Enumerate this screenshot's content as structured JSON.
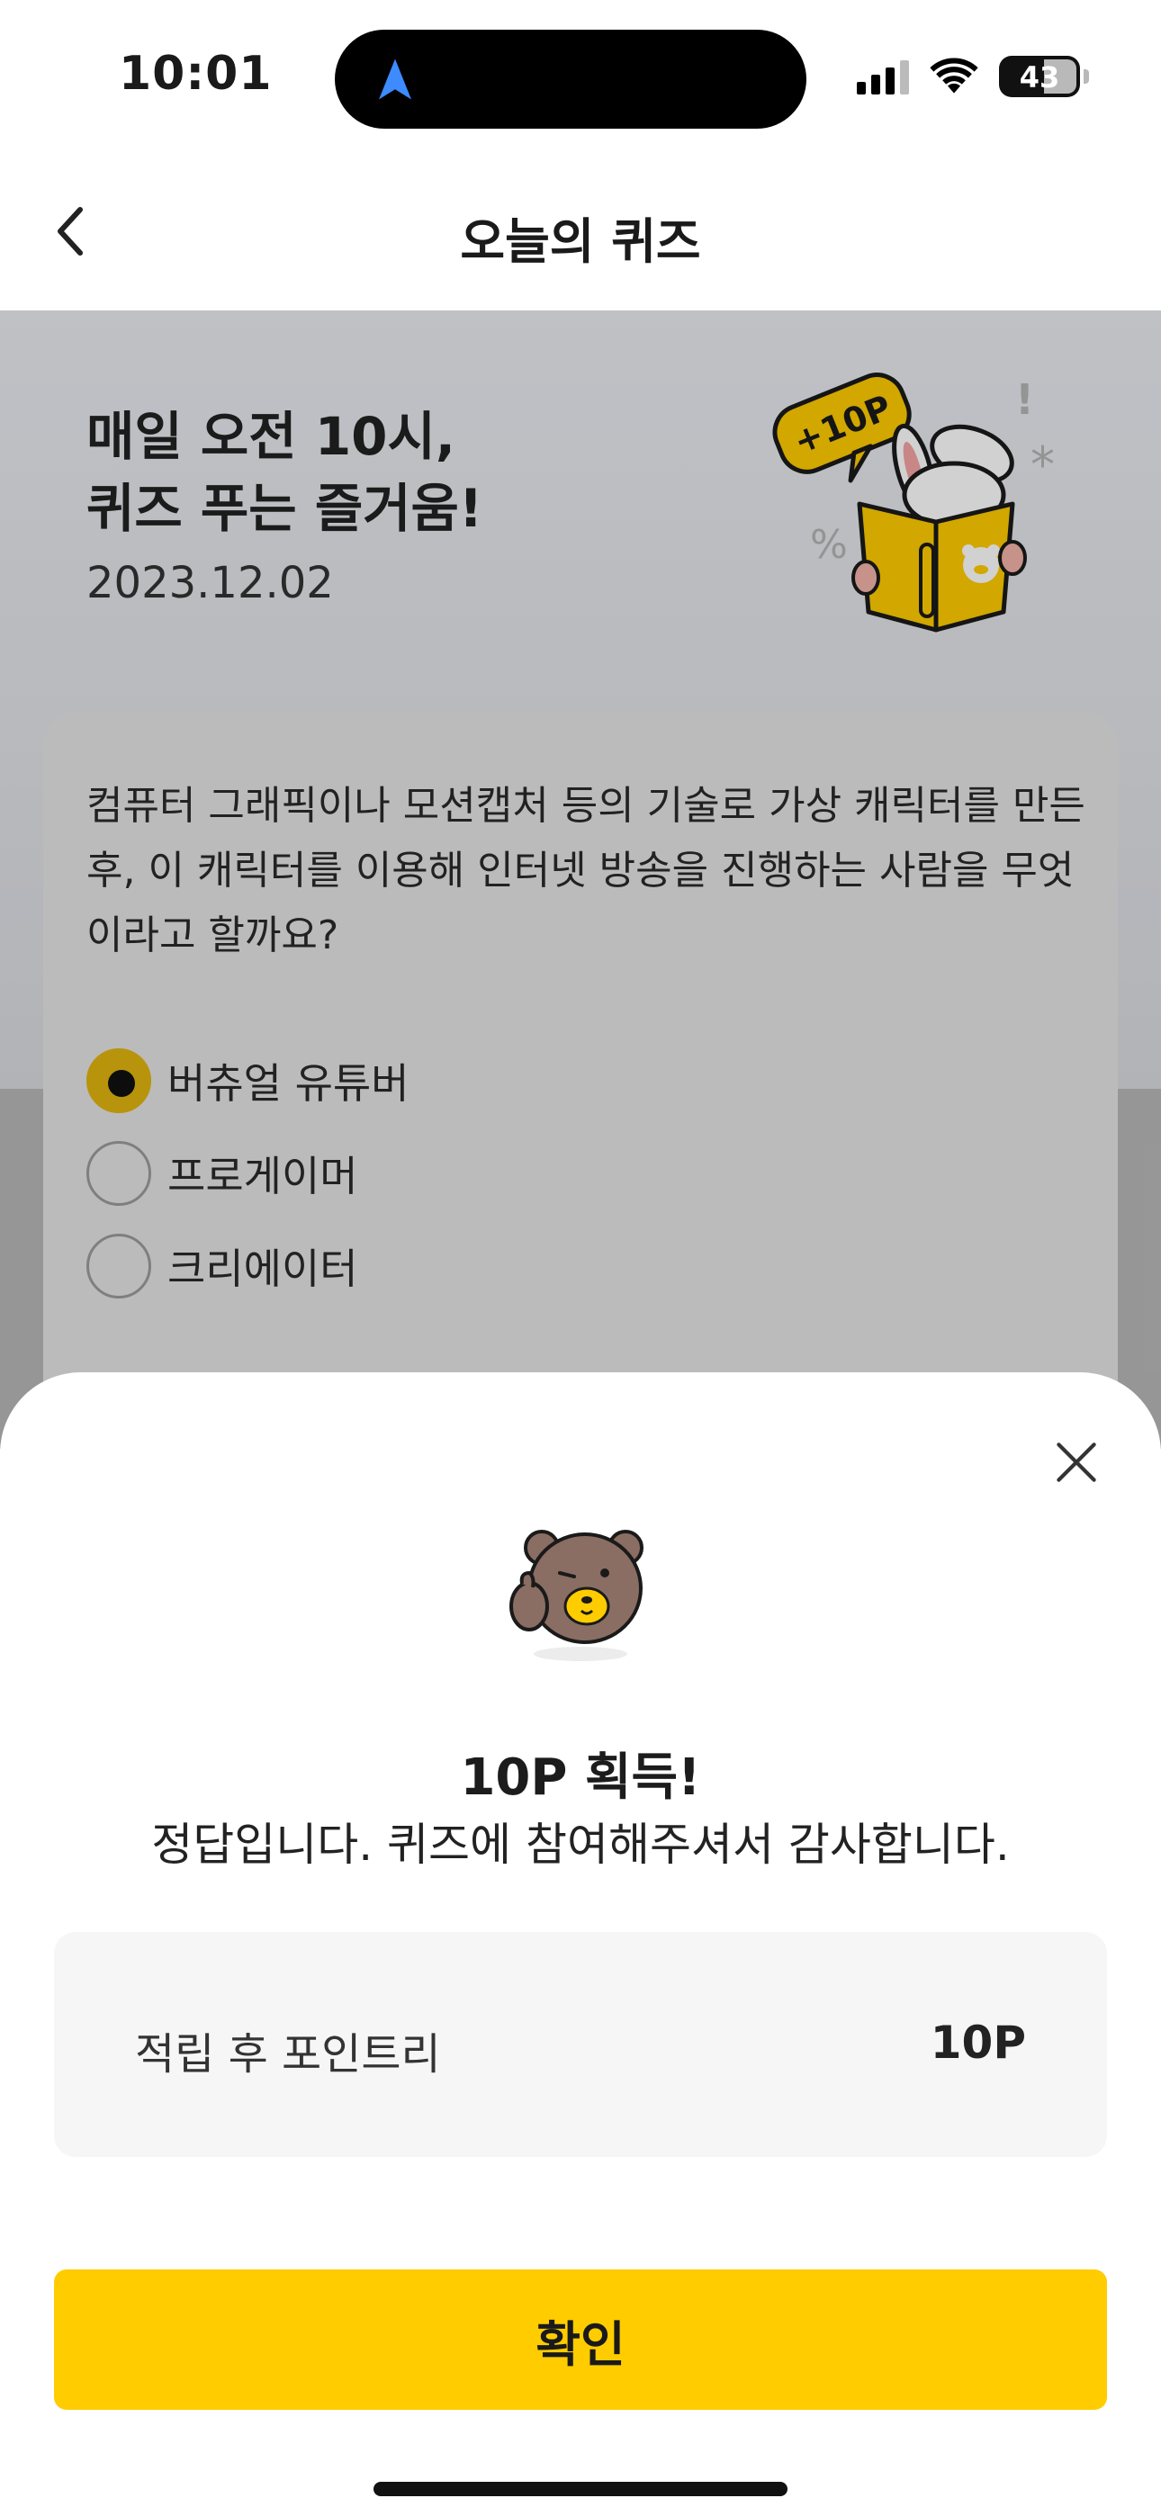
{
  "status_bar": {
    "time": "10:01",
    "battery": "43",
    "icons": [
      "location-arrow-icon",
      "signal-icon",
      "wifi-icon",
      "battery-icon"
    ]
  },
  "header": {
    "title": "오늘의 퀴즈",
    "back_icon": "chevron-left-icon"
  },
  "hero": {
    "title_line1": "매일 오전 10시,",
    "title_line2": "퀴즈 푸는 즐거움!",
    "date": "2023.12.02",
    "badge": "+10P"
  },
  "quiz": {
    "question": "컴퓨터 그래픽이나 모션캡처 등의 기술로 가상 캐릭터를 만든 후, 이 캐릭터를 이용해 인터넷 방송을 진행하는 사람을 무엇이라고 할까요?",
    "options": [
      {
        "label": "버츄얼 유튜버",
        "selected": true
      },
      {
        "label": "프로게이머",
        "selected": false
      },
      {
        "label": "크리에이터",
        "selected": false
      }
    ]
  },
  "sheet": {
    "reward_title": "10P 획득!",
    "message": "정답입니다. 퀴즈에 참여해주셔서 감사합니다.",
    "points_label": "적립 후 포인트리",
    "points_value": "10P",
    "confirm_label": "확인",
    "close_icon": "close-icon"
  },
  "colors": {
    "accent": "#ffcc00",
    "radio_selected": "#e1b40f",
    "hero_bg": "#eaecf1"
  }
}
